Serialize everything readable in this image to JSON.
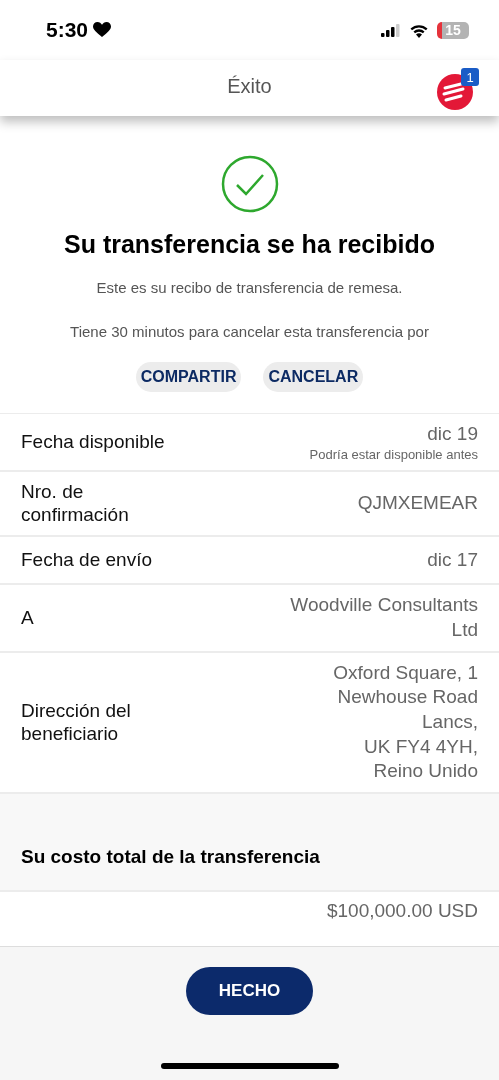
{
  "status_bar": {
    "time": "5:30",
    "battery": "15"
  },
  "header": {
    "title": "Éxito",
    "notification_count": "1"
  },
  "success": {
    "title": "Su transferencia se ha recibido",
    "subtitle": "Este es su recibo de transferencia de remesa.",
    "notice": "Tiene 30 minutos para cancelar esta transferencia por"
  },
  "actions": [
    "COMPARTIR",
    "CANCELAR"
  ],
  "details": [
    {
      "label": "Fecha disponible",
      "value": [
        "dic 19"
      ],
      "note": "Podría estar disponible antes"
    },
    {
      "label": "Nro. de confirmación",
      "value": [
        "QJMXEMEAR"
      ]
    },
    {
      "label": "Fecha de envío",
      "value": [
        "dic 17"
      ]
    },
    {
      "label": "A",
      "value": [
        "Woodville Consultants",
        "Ltd"
      ]
    },
    {
      "label": "Dirección del beneficiario",
      "value": [
        "Oxford Square, 1",
        "Newhouse Road",
        "Lancs,",
        "UK FY4 4YH,",
        "Reino Unido"
      ]
    }
  ],
  "cost": {
    "title": "Su costo total de la transferencia",
    "rows": [
      {
        "value": "$100,000.00 USD"
      }
    ]
  },
  "footer": {
    "button": "HECHO"
  }
}
